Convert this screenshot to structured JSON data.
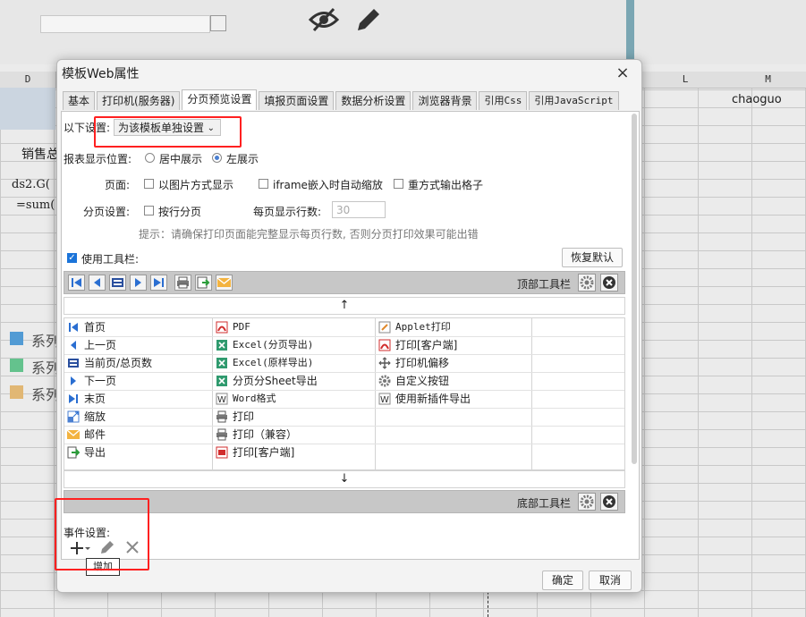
{
  "background": {
    "col_d": "D",
    "col_l": "L",
    "col_m": "M",
    "cell_chaoguo": "chaoguo",
    "cell_xiaoshou": "销售总",
    "cell_ds2": "ds2.G(",
    "cell_sum": "=sum(",
    "legend": [
      "系列",
      "系列",
      "系列"
    ],
    "legend_colors": [
      "#5aa9e6",
      "#6dd39a",
      "#f5c77e"
    ]
  },
  "dialog": {
    "title": "模板Web属性",
    "close_icon": "×",
    "tabs": [
      {
        "label": "基本"
      },
      {
        "label": "打印机(服务器)"
      },
      {
        "label": "分页预览设置"
      },
      {
        "label": "填报页面设置"
      },
      {
        "label": "数据分析设置"
      },
      {
        "label": "浏览器背景"
      },
      {
        "label": "引用Css"
      },
      {
        "label": "引用JavaScript"
      }
    ],
    "active_tab": 2,
    "settings": {
      "mode_label": "以下设置:",
      "mode_value": "为该模板单独设置",
      "position_label": "报表显示位置:",
      "center_label": "居中展示",
      "left_label": "左展示",
      "page_label": "页面:",
      "image_mode_label": "以图片方式显示",
      "iframe_label": "iframe嵌入时自动缩放",
      "redraw_label": "重方式输出格子",
      "paging_label": "分页设置:",
      "row_paging_label": "按行分页",
      "rows_per_page_label": "每页显示行数:",
      "rows_per_page_value": "30",
      "hint": "提示：请确保打印页面能完整显示每页行数, 否则分页打印效果可能出错"
    },
    "toolbar": {
      "use_toolbar_label": "使用工具栏:",
      "restore_default": "恢复默认",
      "top_toolbar_label": "顶部工具栏",
      "bottom_toolbar_label": "底部工具栏",
      "arrow_up": "↑",
      "arrow_down": "↓",
      "items_col1": [
        "首页",
        "上一页",
        "当前页/总页数",
        "下一页",
        "末页",
        "缩放",
        "邮件",
        "导出"
      ],
      "items_col2": [
        "PDF",
        "Excel(分页导出)",
        "Excel(原样导出)",
        "分页分Sheet导出",
        "Word格式",
        "打印",
        "打印（兼容）",
        "打印[客户端]"
      ],
      "items_col3": [
        "Applet打印",
        "打印[客户端]",
        "打印机偏移",
        "自定义按钮",
        "使用新插件导出"
      ]
    },
    "events": {
      "label": "事件设置:",
      "add_tooltip": "增加"
    },
    "footer": {
      "ok": "确定",
      "cancel": "取消"
    }
  }
}
